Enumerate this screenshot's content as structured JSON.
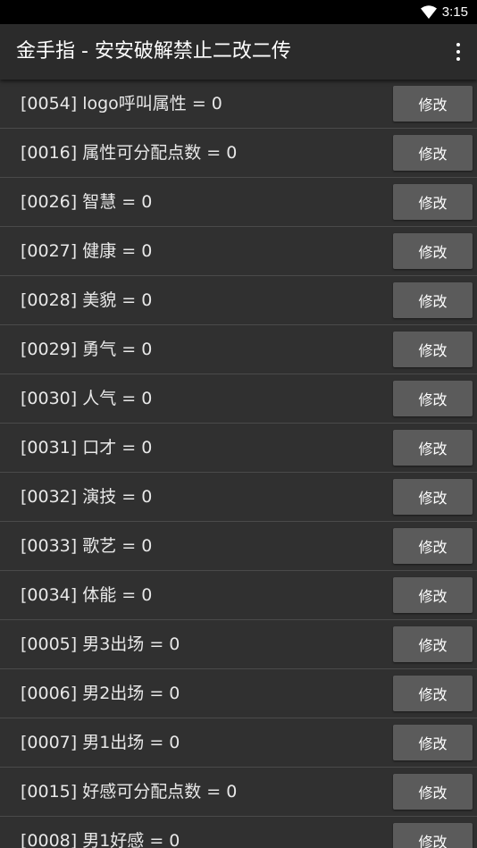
{
  "status_bar": {
    "time": "3:15",
    "wifi_icon": "wifi-icon"
  },
  "app_bar": {
    "title": "金手指 - 安安破解禁止二改二传",
    "menu_icon": "overflow-menu-icon"
  },
  "button_label": "修改",
  "items": [
    {
      "label": "[0054] logo呼叫属性 = 0",
      "button": "修改"
    },
    {
      "label": "[0016] 属性可分配点数 = 0",
      "button": "修改"
    },
    {
      "label": "[0026] 智慧 = 0",
      "button": "修改"
    },
    {
      "label": "[0027] 健康 = 0",
      "button": "修改"
    },
    {
      "label": "[0028] 美貌 = 0",
      "button": "修改"
    },
    {
      "label": "[0029] 勇气 = 0",
      "button": "修改"
    },
    {
      "label": "[0030] 人气 = 0",
      "button": "修改"
    },
    {
      "label": "[0031] 口才 = 0",
      "button": "修改"
    },
    {
      "label": "[0032] 演技 = 0",
      "button": "修改"
    },
    {
      "label": "[0033] 歌艺 = 0",
      "button": "修改"
    },
    {
      "label": "[0034] 体能 = 0",
      "button": "修改"
    },
    {
      "label": "[0005] 男3出场 = 0",
      "button": "修改"
    },
    {
      "label": "[0006] 男2出场 = 0",
      "button": "修改"
    },
    {
      "label": "[0007] 男1出场 = 0",
      "button": "修改"
    },
    {
      "label": "[0015] 好感可分配点数 = 0",
      "button": "修改"
    },
    {
      "label": "[0008] 男1好感 = 0",
      "button": "修改"
    }
  ]
}
